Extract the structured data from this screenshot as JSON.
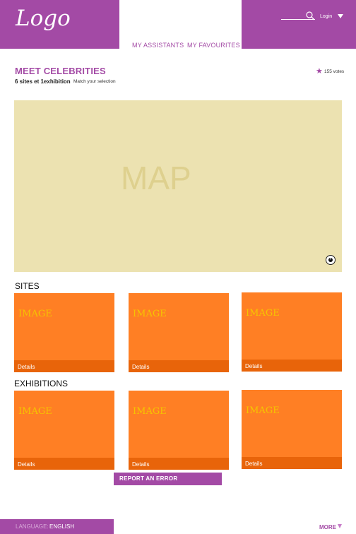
{
  "header": {
    "logo": "Logo",
    "login_label": "Login"
  },
  "nav": {
    "assistants": "MY ASSISTANTS",
    "favourites": "MY FAVOURITES"
  },
  "page": {
    "title": "MEET CELEBRITIES",
    "subtitle": "6 sites et 1exhibition",
    "match_text": "Match your selection",
    "votes": "155 votes"
  },
  "map": {
    "label": "MAP"
  },
  "sites": {
    "title": "SITES",
    "cards": [
      {
        "image_label": "IMAGE",
        "details": "Details"
      },
      {
        "image_label": "IMAGE",
        "details": "Details"
      },
      {
        "image_label": "IMAGE",
        "details": "Details"
      }
    ]
  },
  "exhibitions": {
    "title": "EXHIBITIONS",
    "cards": [
      {
        "image_label": "IMAGE",
        "details": "Details"
      },
      {
        "image_label": "IMAGE",
        "details": "Details"
      },
      {
        "image_label": "IMAGE",
        "details": "Details"
      }
    ]
  },
  "report_error": "REPORT AN ERROR",
  "footer": {
    "language_label": "LANGUAGE:",
    "language_value": "ENGLISH",
    "more_label": "MORE"
  },
  "colors": {
    "brand_purple": "#a34aa5",
    "card_orange": "#ff7f24",
    "card_bar": "#e8640a",
    "map_bg": "#ece2b1"
  }
}
